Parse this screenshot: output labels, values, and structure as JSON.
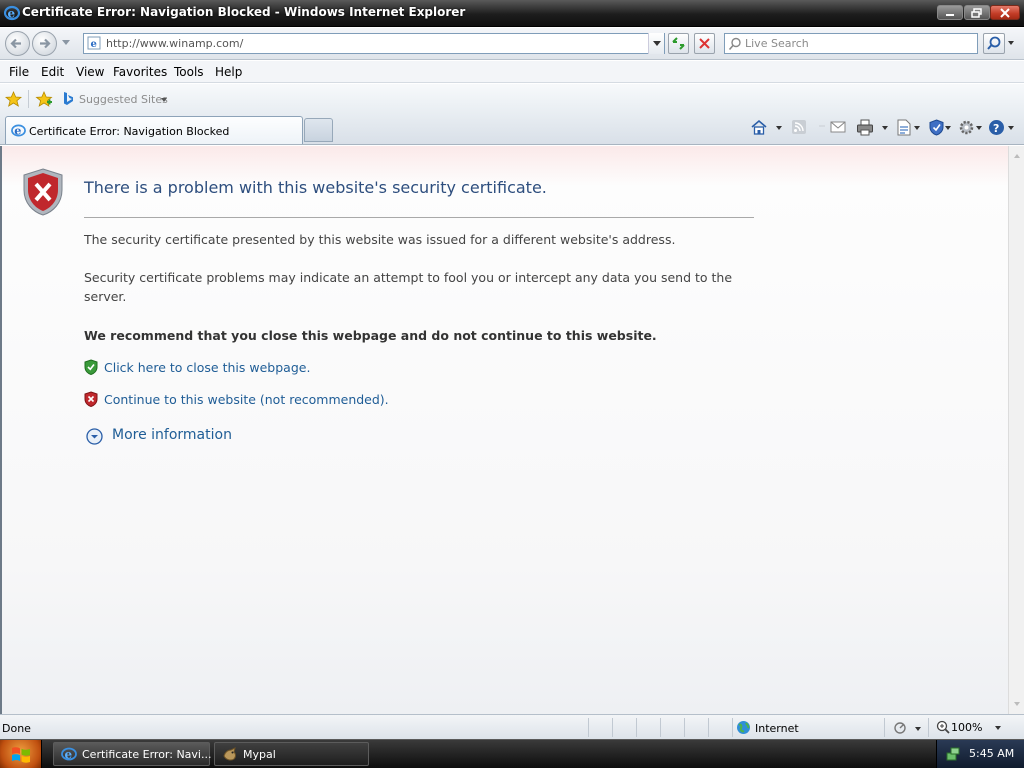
{
  "window": {
    "title": "Certificate Error: Navigation Blocked - Windows Internet Explorer"
  },
  "address_bar": {
    "url": "http://www.winamp.com/",
    "search_placeholder": "Live Search"
  },
  "menu": {
    "items": [
      "File",
      "Edit",
      "View",
      "Favorites",
      "Tools",
      "Help"
    ]
  },
  "favorites_bar": {
    "suggested_sites": "Suggested Sites"
  },
  "tabs": [
    {
      "label": "Certificate Error: Navigation Blocked"
    }
  ],
  "page": {
    "title": "There is a problem with this website's security certificate.",
    "para1": "The security certificate presented by this website was issued for a different website's address.",
    "para2": "Security certificate problems may indicate an attempt to fool you or intercept any data you send to the server.",
    "recommendation": "We recommend that you close this webpage and do not continue to this website.",
    "close_link": "Click here to close this webpage.",
    "continue_link": "Continue to this website (not recommended).",
    "more_info": "More information"
  },
  "status_bar": {
    "status": "Done",
    "zone": "Internet",
    "zoom": "100%"
  },
  "taskbar": {
    "tasks": [
      {
        "label": "Certificate Error: Navi..."
      },
      {
        "label": "Mypal"
      }
    ],
    "clock": "5:45 AM"
  },
  "colors": {
    "title_blue": "#2e4e7e",
    "link_blue": "#1f5d96",
    "shield_red": "#c0282d",
    "shield_green": "#3a9a3a"
  }
}
